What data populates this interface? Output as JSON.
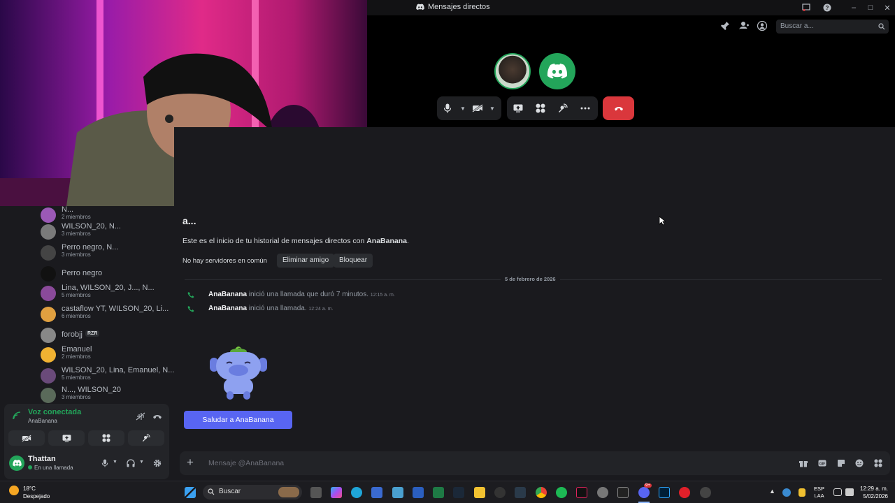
{
  "window": {
    "title": "Mensajes directos",
    "search_placeholder": "Buscar a..."
  },
  "call": {
    "participants": [
      "AnaBanana",
      "Thattan"
    ],
    "controls": [
      "microphone",
      "camera-off",
      "screen-share",
      "activities",
      "soundboard",
      "more",
      "hang-up"
    ]
  },
  "sidebar": {
    "dms": [
      {
        "name": "N...",
        "sub": "2 miembros",
        "color": "#9b59b6"
      },
      {
        "name": "WILSON_20, N...",
        "sub": "3 miembros",
        "color": "#7a7a7a"
      },
      {
        "name": "Perro negro, N...",
        "sub": "3 miembros",
        "color": "#444"
      },
      {
        "name": "Perro negro",
        "sub": "",
        "color": "#111"
      },
      {
        "name": "Lina, WILSON_20, J..., N...",
        "sub": "5 miembros",
        "color": "#8a4a9a"
      },
      {
        "name": "castaflow YT, WILSON_20, Li...",
        "sub": "6 miembros",
        "color": "#e0a040"
      },
      {
        "name": "forobjj",
        "sub": "",
        "color": "#888",
        "badge": "RZR"
      },
      {
        "name": "Emanuel",
        "sub": "2 miembros",
        "color": "#f0b232"
      },
      {
        "name": "WILSON_20, Lina, Emanuel, N...",
        "sub": "5 miembros",
        "color": "#6a4a7a"
      },
      {
        "name": "N..., WILSON_20",
        "sub": "3 miembros",
        "color": "#5a6a5a"
      }
    ]
  },
  "voice": {
    "status": "Voz conectada",
    "channel": "AnaBanana"
  },
  "user": {
    "name": "Thattan",
    "status": "En una llamada"
  },
  "main": {
    "heading": "a...",
    "intro_prefix": "Este es el inicio de tu historial de mensajes directos con ",
    "intro_name": "AnaBanana",
    "intro_suffix": ".",
    "no_servers": "No hay servidores en común",
    "remove_friend": "Eliminar amigo",
    "block": "Bloquear",
    "date_divider": "5 de febrero de 2026",
    "messages": [
      {
        "author": "AnaBanana",
        "text": " inició una llamada que duró 7 minutos.",
        "time": "12:15 a. m."
      },
      {
        "author": "AnaBanana",
        "text": " inició una llamada.",
        "time": "12:24 a. m."
      }
    ],
    "wave_button": "Saludar a AnaBanana",
    "composer_placeholder": "Mensaje @AnaBanana"
  },
  "taskbar": {
    "weather_temp": "18°C",
    "weather_desc": "Despejado",
    "search": "Buscar",
    "lang1": "ESP",
    "lang2": "LAA",
    "time": "12:29 a. m.",
    "date": "5/02/2026",
    "badge": "9+"
  },
  "colors": {
    "accent": "#5865f2",
    "danger": "#da373c",
    "online": "#23a55a"
  }
}
